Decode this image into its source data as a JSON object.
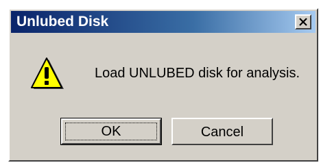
{
  "window": {
    "title": "Unlubed Disk",
    "close_glyph": "✕"
  },
  "dialog": {
    "icon": "warning-icon",
    "message": "Load UNLUBED disk for analysis."
  },
  "buttons": {
    "ok_label": "OK",
    "cancel_label": "Cancel"
  },
  "colors": {
    "title_bar_start": "#0a246a",
    "title_bar_end": "#a6caf0",
    "face": "#d4d0c8",
    "warning_fill": "#ffff00"
  }
}
